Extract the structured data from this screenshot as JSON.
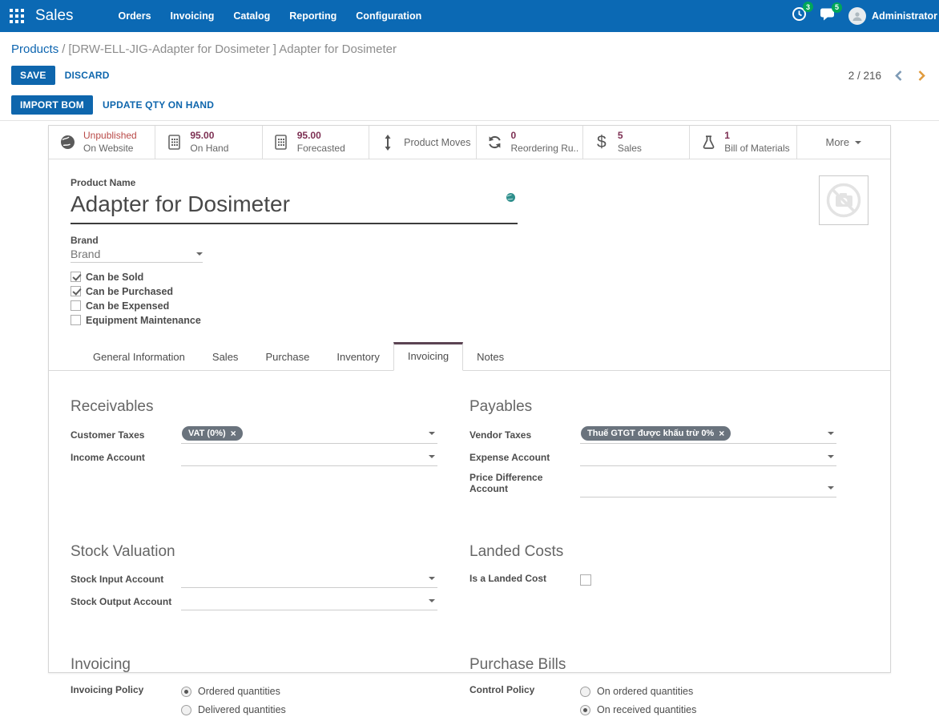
{
  "colors": {
    "navbar_blue": "#0b69b4",
    "primary_button_blue": "#0e66ad",
    "link_blue": "#0d65b0",
    "badge_green": "#00a65a",
    "stat_value_maroon": "#7d3053",
    "unpublished_red": "#b94a48",
    "tag_background": "#6a737d",
    "active_tab_border": "#5b4453"
  },
  "nav": {
    "app_name": "Sales",
    "menus": [
      "Orders",
      "Invoicing",
      "Catalog",
      "Reporting",
      "Configuration"
    ],
    "activity_badge": "3",
    "message_badge": "5",
    "user_name": "Administrator"
  },
  "breadcrumb": {
    "parent": "Products",
    "separator": "/",
    "current": "[DRW-ELL-JIG-Adapter for Dosimeter ] Adapter for Dosimeter"
  },
  "control_panel": {
    "save": "SAVE",
    "discard": "DISCARD",
    "import_bom": "IMPORT BOM",
    "update_qty": "UPDATE QTY ON HAND",
    "pager": "2 / 216"
  },
  "stat_buttons": [
    {
      "icon": "globe-icon",
      "value": "Unpublished",
      "label": "On Website"
    },
    {
      "icon": "calculator-icon",
      "value": "95.00",
      "label": "On Hand"
    },
    {
      "icon": "calculator-icon",
      "value": "95.00",
      "label": "Forecasted"
    },
    {
      "icon": "arrows-vertical-icon",
      "label": "Product Moves"
    },
    {
      "icon": "refresh-icon",
      "value": "0",
      "label": "Reordering Ru..."
    },
    {
      "icon": "dollar-icon",
      "value": "5",
      "label": "Sales"
    },
    {
      "icon": "flask-icon",
      "value": "1",
      "label": "Bill of Materials"
    },
    {
      "label": "More"
    }
  ],
  "product": {
    "name_label": "Product Name",
    "name": "Adapter for Dosimeter",
    "brand_label": "Brand",
    "brand_placeholder": "Brand",
    "checkboxes": [
      {
        "label": "Can be Sold",
        "checked": true
      },
      {
        "label": "Can be Purchased",
        "checked": true
      },
      {
        "label": "Can be Expensed",
        "checked": false
      },
      {
        "label": "Equipment Maintenance",
        "checked": false
      }
    ]
  },
  "tabs": {
    "items": [
      "General Information",
      "Sales",
      "Purchase",
      "Inventory",
      "Invoicing",
      "Notes"
    ],
    "active": "Invoicing"
  },
  "sections": {
    "receivables": {
      "title": "Receivables",
      "rows": [
        {
          "label": "Customer Taxes",
          "tag": "VAT (0%)"
        },
        {
          "label": "Income Account",
          "tag": ""
        }
      ]
    },
    "payables": {
      "title": "Payables",
      "rows": [
        {
          "label": "Vendor Taxes",
          "tag": "Thuế GTGT được khấu trừ 0%"
        },
        {
          "label": "Expense Account",
          "tag": ""
        },
        {
          "label": "Price Difference Account",
          "tag": ""
        }
      ]
    },
    "stock_valuation": {
      "title": "Stock Valuation",
      "rows": [
        {
          "label": "Stock Input Account",
          "tag": ""
        },
        {
          "label": "Stock Output Account",
          "tag": ""
        }
      ]
    },
    "landed_costs": {
      "title": "Landed Costs",
      "row_label": "Is a Landed Cost",
      "checked": false
    },
    "invoicing": {
      "title": "Invoicing",
      "policy_label": "Invoicing Policy",
      "options": [
        {
          "label": "Ordered quantities",
          "selected": true
        },
        {
          "label": "Delivered quantities",
          "selected": false
        }
      ]
    },
    "purchase_bills": {
      "title": "Purchase Bills",
      "policy_label": "Control Policy",
      "options": [
        {
          "label": "On ordered quantities",
          "selected": false
        },
        {
          "label": "On received quantities",
          "selected": true
        }
      ]
    }
  }
}
